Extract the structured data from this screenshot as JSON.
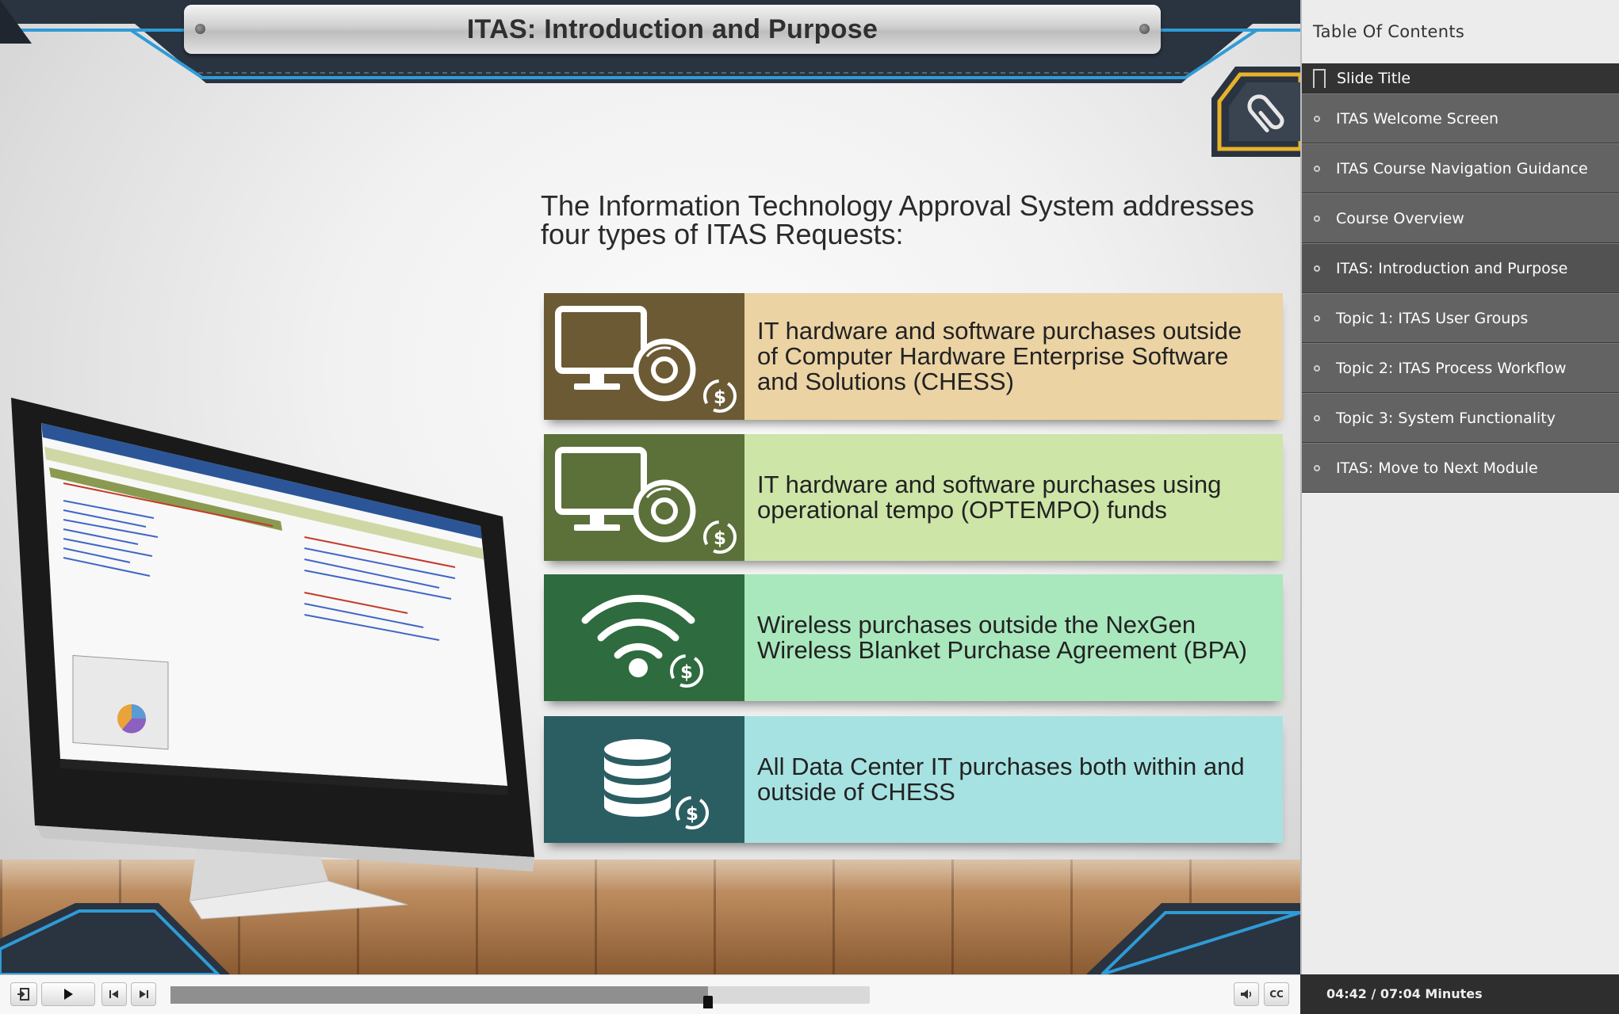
{
  "slide": {
    "title": "ITAS: Introduction and Purpose",
    "heading_line1": "The Information Technology Approval System addresses",
    "heading_line2": "four types of ITAS Requests:",
    "attachments_icon": "paperclip-icon",
    "cards": [
      {
        "icon": "monitor-disc-dollar-icon",
        "color": "#6b5a34",
        "bg": "#ebd3a4",
        "lines": [
          "IT hardware and software purchases outside",
          "of Computer Hardware Enterprise Software",
          "and Solutions (CHESS)"
        ]
      },
      {
        "icon": "monitor-disc-dollar-icon",
        "color": "#5c703a",
        "bg": "#cde5a7",
        "lines": [
          "IT hardware and software purchases using",
          "operational tempo (OPTEMPO) funds"
        ]
      },
      {
        "icon": "wifi-dollar-icon",
        "color": "#2e6b3e",
        "bg": "#a9e7bd",
        "lines": [
          "Wireless purchases outside the NexGen",
          "Wireless Blanket Purchase Agreement (BPA)"
        ]
      },
      {
        "icon": "database-dollar-icon",
        "color": "#2b5e62",
        "bg": "#a7e2e2",
        "lines": [
          "All Data Center IT purchases both within and",
          "outside of CHESS"
        ]
      }
    ]
  },
  "toc": {
    "header": "Table Of Contents",
    "subheader": "Slide Title",
    "items": [
      {
        "label": "ITAS Welcome Screen"
      },
      {
        "label": "ITAS Course Navigation Guidance"
      },
      {
        "label": "Course Overview"
      },
      {
        "label": "ITAS: Introduction and Purpose",
        "active": true
      },
      {
        "label": "Topic 1: ITAS User Groups"
      },
      {
        "label": "Topic 2: ITAS Process Workflow"
      },
      {
        "label": "Topic 3: System Functionality"
      },
      {
        "label": "ITAS: Move to Next Module"
      }
    ]
  },
  "player": {
    "buttons": [
      "exit-icon",
      "play-icon",
      "previous-icon",
      "next-icon",
      "volume-icon",
      "cc-icon"
    ],
    "cc_label": "CC",
    "progress": 0.769,
    "time": "04:42 / 07:04 Minutes"
  }
}
